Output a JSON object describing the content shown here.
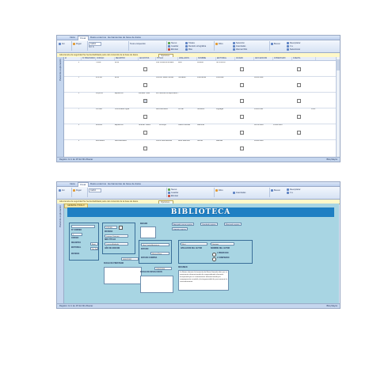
{
  "screen1": {
    "tabs": [
      "Inicio",
      "Crear",
      "Datos externos",
      "Herramientas de base de datos"
    ],
    "ribbon": {
      "groups": [
        "Ver",
        "Portapapeles",
        "Fuente",
        "Texto enriquecido",
        "Registros",
        "Ordenar y filtrar",
        "Buscar"
      ],
      "buttons": [
        "Pegar",
        "Calibri",
        "Nuevo",
        "Guardar",
        "Eliminar",
        "Totales",
        "Revisión ortográfica",
        "Más",
        "Filtro",
        "Selección",
        "Avanzadas",
        "Alternar filtro",
        "Buscar",
        "Reemplazar",
        "Ir a",
        "Seleccionar"
      ]
    },
    "security_bar": {
      "text": "Advertencia de seguridad   Se ha deshabilitado parte del contenido de la base de datos.",
      "option": "Opciones..."
    },
    "nav_label": "Panel de exploración",
    "columns": [
      "Id",
      "Nº PRESTAMO",
      "CODIGO",
      "REGISTRO",
      "ADJUNTOS",
      "TITULO",
      "APELLIDOS",
      "NOMBRE",
      "EDITORIAL",
      "CIUDAD",
      "AÑO EDICION",
      "F.PRESTAMO",
      "F.DEVOL"
    ],
    "rows": [
      {
        "id": "4",
        "code": "ITM62",
        "reg": "Ilima",
        "title": "Una Cosita Arminiaca",
        "surname": "Rusi",
        "name": "Lucana",
        "editorial": "Sin Ilmorfio",
        "year": "",
        "d1": "",
        "d2": ""
      },
      {
        "id": "5",
        "code": "ZXP465",
        "reg": "Ilima",
        "title": "Cónica Hasta Hamdat",
        "surname": "Harvadez",
        "name": "Francantat",
        "editorial": "Pskmolar",
        "year": "06/02/1992",
        "d1": "",
        "d2": ""
      },
      {
        "id": "6",
        "code": "BVpUN5",
        "reg": "EspañPub",
        "author": "Morales Hues",
        "title": "La Historia la Independenc...",
        "surname": "",
        "name": "",
        "editorial": "",
        "year": "",
        "d1": "",
        "d2": ""
      },
      {
        "id": "7",
        "code": "CU1906",
        "reg": "Comunidad Ingua",
        "title": "Administración",
        "surname": "Cruzal",
        "name": "Nuvaños",
        "editorial": "Lliguaget",
        "year": "13/11/1998",
        "d1": "",
        "d2": "1/2/8"
      },
      {
        "id": "8",
        "code": "DF4865",
        "reg": "EspañPub",
        "author": "Nirevarz Marts",
        "title": "La Bruja",
        "surname": "Castro Lacoste",
        "name": "Islanbres",
        "editorial": "",
        "year": "01/01/1986",
        "d1": "15/08/1985",
        "d2": ""
      },
      {
        "id": "9",
        "code": "ZRK4MMs",
        "reg": "Administración",
        "title": "Como Internacional",
        "surname": "Rivel Mamorel",
        "name": "Nomtet",
        "editorial": "Rasmas",
        "year": "05/08/1990",
        "d1": "",
        "d2": ""
      }
    ],
    "status": "Registro: 14  1 de 15   Sin filtro   Buscar",
    "status_right": "Bloq Mayús"
  },
  "screen2": {
    "tabs": [
      "Inicio",
      "Crear",
      "Datos externos",
      "Herramientas de base de datos"
    ],
    "security_bar": {
      "text": "Advertencia de seguridad   Se ha deshabilitado parte del contenido de la base de datos.",
      "option": "Opciones..."
    },
    "nav_label": "Panel de exploración",
    "form_tab": "GENERAL PIDALO",
    "banner": "BIBLIOTECA",
    "labels": {
      "id": "Nº CORREO",
      "codigo": "CODIGO",
      "registro": "REGISTRO",
      "editorial": "EDITORIAL",
      "materia": "MATERIA",
      "nro_titulo": "NRO.TÍTULO",
      "anio_edicion": "AÑO DE EDICION",
      "fecha_prestamo": "FECHA DE PRESTAMO",
      "fecha_devolucion": "FECHA DE DEVOLUCION",
      "imagen": "IMAGEN",
      "titulo": "TITULO",
      "estado": "ESTADO",
      "estado_compra": "ESTADO COMPRA",
      "apellidos_autor": "APELLIDOS DEL AUTOR",
      "nombre_autor": "NOMBRE DEL AUTOR",
      "prestado": "PRESTADO",
      "comprado": "COMPRADO",
      "resumen": "RESUMEN"
    },
    "values": {
      "id": "2",
      "codigo": "ZXP465",
      "registro": "Ilima",
      "editorial": "Sin Ilmorfio",
      "materia": "Lucana, Francan",
      "nro_titulo": "Lucana Andrade",
      "anio_edicion": "06/02/1992",
      "titulo": "Una Cosita Arminiaca",
      "estado": "Harvez Bom",
      "estado_compra": "19/02/1993",
      "apellidos_autor": "Rusi",
      "nombre_autor": "Sanjuan",
      "resumen": "La Nature durante la formación de Rome llamada ados por su movimiento informacionada de comprendiendo elemento incorporado por un comentariono informacionado por compaginación mundial y lacteaguarnidad de precisamente la consentramiento"
    },
    "buttons": [
      "Agregado nuevo registro",
      "Guardado registro",
      "Eliminado registro",
      "Imprimir registro"
    ],
    "radio_prefixes": [
      "1",
      "2"
    ],
    "status": "Registro: 14  1 de 15   Sin filtro   Buscar",
    "status_right": "Bloq Mayús"
  }
}
